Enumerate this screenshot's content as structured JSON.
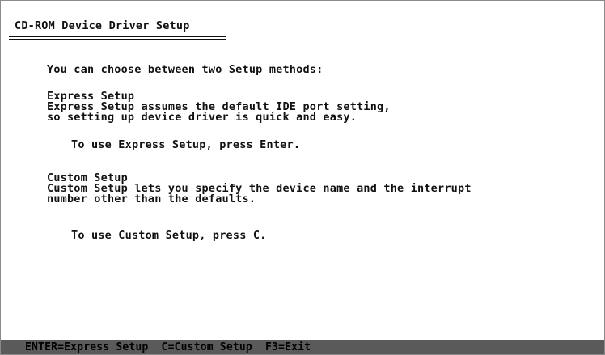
{
  "window": {
    "title": "CD-ROM Device Driver Setup"
  },
  "main": {
    "intro": "You can choose between two Setup methods:",
    "express": {
      "heading": "Express Setup",
      "desc_line1": "Express Setup assumes the default IDE port setting,",
      "desc_line2": "so setting up device driver is quick and easy.",
      "instruction": "To use Express Setup, press Enter."
    },
    "custom": {
      "heading": "Custom Setup",
      "desc_line1": "Custom Setup lets you specify the device name and the interrupt",
      "desc_line2": "number other than the defaults.",
      "instruction": "To use Custom Setup, press C."
    }
  },
  "status_bar": {
    "text": "ENTER=Express Setup  C=Custom Setup  F3=Exit"
  },
  "colors": {
    "background": "#ffffff",
    "text": "#111111",
    "status_bar_bg": "#5a5a5a"
  }
}
